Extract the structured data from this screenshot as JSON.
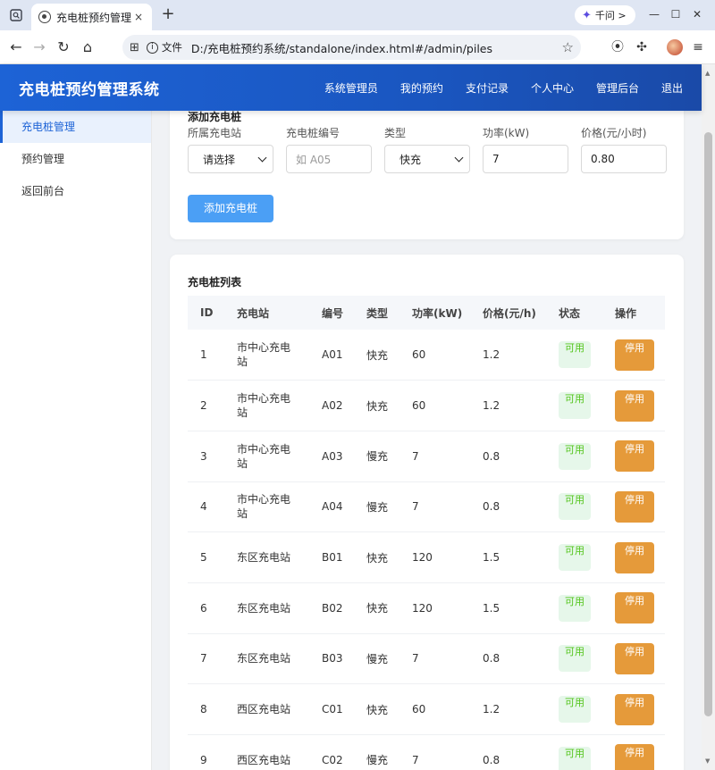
{
  "browser": {
    "tab_title": "充电桩预约管理系",
    "tab_close": "×",
    "new_tab": "+",
    "qianwen_label": "千问 >",
    "file_label": "文件",
    "url": "D:/充电桩预约系统/standalone/index.html#/admin/piles"
  },
  "app": {
    "title": "充电桩预约管理系统",
    "nav": [
      "系统管理员",
      "我的预约",
      "支付记录",
      "个人中心",
      "管理后台",
      "退出"
    ]
  },
  "sidebar": {
    "items": [
      {
        "label": "充电桩管理",
        "active": true
      },
      {
        "label": "预约管理",
        "active": false
      },
      {
        "label": "返回前台",
        "active": false
      }
    ]
  },
  "add_form": {
    "title": "添加充电桩",
    "fields": {
      "station": {
        "label": "所属充电站",
        "value": "请选择"
      },
      "code": {
        "label": "充电桩编号",
        "placeholder": "如 A05"
      },
      "type": {
        "label": "类型",
        "value": "快充"
      },
      "power": {
        "label": "功率(kW)",
        "value": "7"
      },
      "price": {
        "label": "价格(元/小时)",
        "value": "0.80"
      }
    },
    "submit_label": "添加充电桩"
  },
  "pile_list": {
    "title": "充电桩列表",
    "headers": [
      "ID",
      "充电站",
      "编号",
      "类型",
      "功率(kW)",
      "价格(元/h)",
      "状态",
      "操作"
    ],
    "rows": [
      {
        "id": "1",
        "station": "市中心充电站",
        "code": "A01",
        "type": "快充",
        "power": "60",
        "price": "1.2",
        "status": "可用",
        "action": "停用"
      },
      {
        "id": "2",
        "station": "市中心充电站",
        "code": "A02",
        "type": "快充",
        "power": "60",
        "price": "1.2",
        "status": "可用",
        "action": "停用"
      },
      {
        "id": "3",
        "station": "市中心充电站",
        "code": "A03",
        "type": "慢充",
        "power": "7",
        "price": "0.8",
        "status": "可用",
        "action": "停用"
      },
      {
        "id": "4",
        "station": "市中心充电站",
        "code": "A04",
        "type": "慢充",
        "power": "7",
        "price": "0.8",
        "status": "可用",
        "action": "停用"
      },
      {
        "id": "5",
        "station": "东区充电站",
        "code": "B01",
        "type": "快充",
        "power": "120",
        "price": "1.5",
        "status": "可用",
        "action": "停用"
      },
      {
        "id": "6",
        "station": "东区充电站",
        "code": "B02",
        "type": "快充",
        "power": "120",
        "price": "1.5",
        "status": "可用",
        "action": "停用"
      },
      {
        "id": "7",
        "station": "东区充电站",
        "code": "B03",
        "type": "慢充",
        "power": "7",
        "price": "0.8",
        "status": "可用",
        "action": "停用"
      },
      {
        "id": "8",
        "station": "西区充电站",
        "code": "C01",
        "type": "快充",
        "power": "60",
        "price": "1.2",
        "status": "可用",
        "action": "停用"
      },
      {
        "id": "9",
        "station": "西区充电站",
        "code": "C02",
        "type": "慢充",
        "power": "7",
        "price": "0.8",
        "status": "可用",
        "action": "停用"
      }
    ]
  },
  "colors": {
    "header": "#1d63d6",
    "primary_button": "#4b9ff5",
    "status_available": "#52c41a",
    "disable_button": "#e59a3a"
  }
}
